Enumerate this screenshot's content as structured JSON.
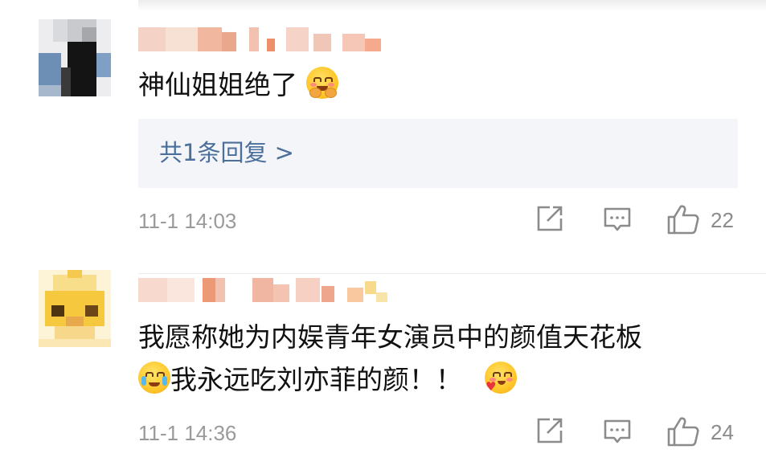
{
  "comments": [
    {
      "text_lines": [
        "神仙姐姐绝了"
      ],
      "emojis": [
        "hugging-face-icon"
      ],
      "replies_label": "共1条回复 >",
      "timestamp": "11-1 14:03",
      "like_count": "22",
      "avatar_pixelated": true,
      "username_pixelated": true
    },
    {
      "text_lines": [
        "我愿称她为内娱青年女演员中的颜值天花板",
        "我永远吃刘亦菲的颜！！"
      ],
      "emojis": [
        "crying-face-icon",
        "heart-face-icon"
      ],
      "timestamp": "11-1 14:36",
      "like_count": "24",
      "avatar_pixelated": true,
      "username_pixelated": true
    }
  ],
  "icons": {
    "share": "share-icon",
    "comment": "comment-icon",
    "like": "thumbs-up-icon"
  },
  "colors": {
    "reply_link": "#4a6f9b",
    "reply_bg": "#f4f5f9",
    "meta_text": "#9a9a9a",
    "icon_stroke": "#8b8b8b"
  }
}
